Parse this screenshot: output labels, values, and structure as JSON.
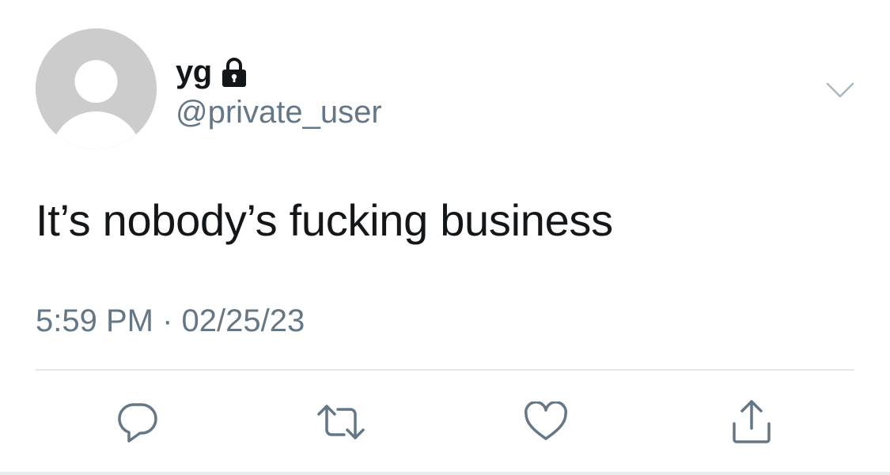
{
  "tweet": {
    "author": {
      "display_name": "yg",
      "handle": "@private_user",
      "protected_icon": "lock-icon",
      "avatar_icon": "default-avatar-icon"
    },
    "text": "It’s nobody’s fucking business",
    "timestamp": "5:59 PM · 02/25/23",
    "menu_icon": "chevron-down-icon",
    "actions": [
      {
        "name": "reply",
        "icon": "reply-icon"
      },
      {
        "name": "retweet",
        "icon": "retweet-icon"
      },
      {
        "name": "like",
        "icon": "heart-icon"
      },
      {
        "name": "share",
        "icon": "share-icon"
      }
    ]
  },
  "colors": {
    "primary_text": "#14171a",
    "secondary_text": "#657786",
    "icon": "#657786",
    "divider": "#e1e8ed",
    "avatar_bg": "#cccccc"
  }
}
